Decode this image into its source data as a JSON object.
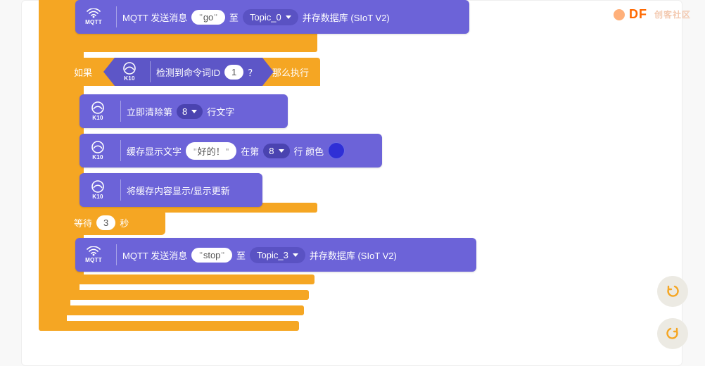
{
  "watermark": {
    "brand": "DF",
    "suffix": "创客社区"
  },
  "icons": {
    "mqtt": "MQTT",
    "k10": "K10"
  },
  "blocks": {
    "mqtt1": {
      "prefix": "MQTT 发送消息",
      "msg": "go",
      "to": "至",
      "topic": "Topic_0",
      "suffix": "并存数据库 (SIoT V2)"
    },
    "if": {
      "if": "如果",
      "cond_prefix": "检测到命令词ID",
      "cond_val": "1",
      "cond_suffix": "？",
      "then": "那么执行"
    },
    "clear": {
      "prefix": "立即清除第",
      "val": "8",
      "suffix": "行文字"
    },
    "cache": {
      "prefix": "缓存显示文字",
      "text": "好的！",
      "at": "在第",
      "line": "8",
      "line_suffix": "行 颜色"
    },
    "refresh": {
      "text": "将缓存内容显示/显示更新"
    },
    "wait": {
      "prefix": "等待",
      "val": "3",
      "suffix": "秒"
    },
    "mqtt2": {
      "prefix": "MQTT 发送消息",
      "msg": "stop",
      "to": "至",
      "topic": "Topic_3",
      "suffix": "并存数据库 (SIoT V2)"
    }
  },
  "colors": {
    "orange": "#f5a623",
    "purple": "#6c63d8",
    "swatch": "#2f2fd6"
  }
}
